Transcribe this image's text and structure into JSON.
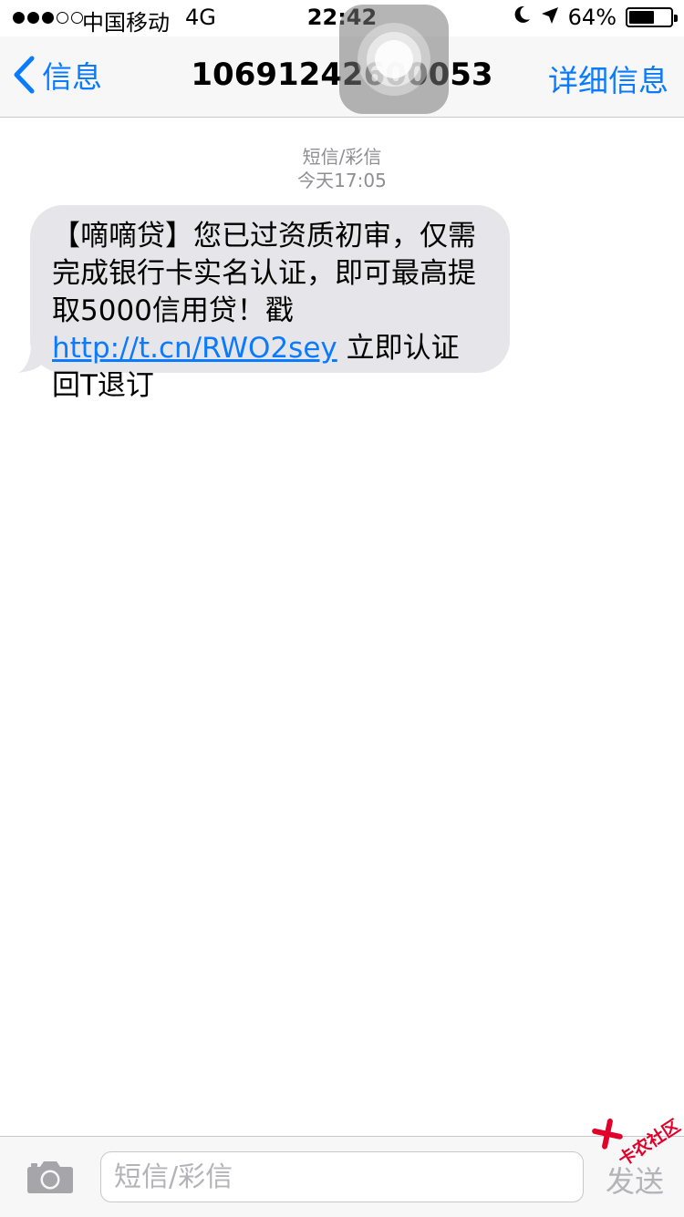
{
  "status_bar": {
    "carrier": "中国移动",
    "network": "4G",
    "time": "22:42",
    "battery_percent": "64%",
    "battery_level": 0.64,
    "signal_bars_filled": 3,
    "signal_bars_total": 5
  },
  "nav": {
    "back_label": "信息",
    "title": "10691242600053",
    "details_label": "详细信息"
  },
  "thread": {
    "message_type": "短信/彩信",
    "timestamp": "今天17:05",
    "message": {
      "text_before_link": "【嘀嘀贷】您已过资质初审，仅需完成银行卡实名认证，即可最高提取5000信用贷！戳 ",
      "link": "http://t.cn/RWO2sey",
      "text_after_link": " 立即认证 回T退订"
    }
  },
  "composer": {
    "placeholder": "短信/彩信",
    "send_label": "发送"
  },
  "watermark": {
    "text": "卡农社区"
  },
  "colors": {
    "accent": "#0a7aff",
    "bubble": "#e5e5ea",
    "meta_text": "#8e8e93",
    "bar_background": "#f7f7f8",
    "watermark": "#e0002a"
  }
}
